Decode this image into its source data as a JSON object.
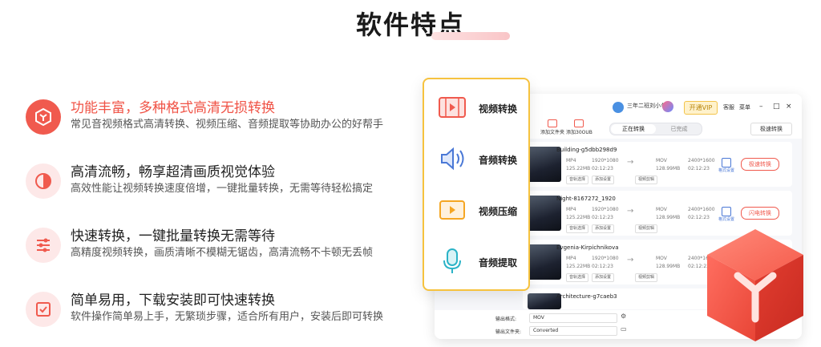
{
  "page_title": "软件特点",
  "features": [
    {
      "title": "功能丰富，多种格式高清无损转换",
      "desc": "常见音视频格式高清转换、视频压缩、音频提取等协助办公的好帮手",
      "icon": "cube-icon",
      "active": true
    },
    {
      "title": "高清流畅，畅享超清画质视觉体验",
      "desc": "高效性能让视频转换速度倍增，一键批量转换，无需等待轻松搞定",
      "icon": "contrast-icon",
      "active": false
    },
    {
      "title": "快速转换，一键批量转换无需等待",
      "desc": "高精度视频转换，画质清晰不模糊无锯齿，高清流畅不卡顿无丢帧",
      "icon": "sliders-icon",
      "active": false
    },
    {
      "title": "简单易用，下载安装即可快速转换",
      "desc": "软件操作简单易上手，无繁琐步骤，适合所有用户，安装后即可转换",
      "icon": "check-icon",
      "active": false
    }
  ],
  "card_items": [
    {
      "label": "视频转换",
      "icon": "video-film-icon"
    },
    {
      "label": "音频转换",
      "icon": "speaker-icon"
    },
    {
      "label": "视频压缩",
      "icon": "compress-icon"
    },
    {
      "label": "音频提取",
      "icon": "microphone-icon"
    }
  ],
  "app": {
    "user_name": "三年二班刘小冬",
    "vip_label": "开通VIP",
    "top_links": [
      "客服",
      "菜单"
    ],
    "toolbar": [
      "添加文件夹",
      "添加30OUB"
    ],
    "tabs": [
      "正在转换",
      "已完成"
    ],
    "speed_button": "极速转换",
    "rows": [
      {
        "name": "Building-g5dbb298d9",
        "src_format": "MP4",
        "src_res": "1920*1080",
        "src_size": "125.22MB",
        "src_time": "02:12:23",
        "dst_format": "MOV",
        "dst_res": "2400*1600",
        "dst_size": "128.99MB",
        "dst_time": "02:12:23",
        "btn_subtitle": "音轨选择",
        "btn_audio": "添加设置",
        "btn_edit": "视频剪辑",
        "fmt_label": "格式设置",
        "action": "极速转换"
      },
      {
        "name": "Night-8167272_1920",
        "src_format": "MP4",
        "src_res": "1920*1080",
        "src_size": "125.22MB",
        "src_time": "02:12:23",
        "dst_format": "MOV",
        "dst_res": "2400*1600",
        "dst_size": "128.99MB",
        "dst_time": "02:12:23",
        "btn_subtitle": "音轨选择",
        "btn_audio": "添加设置",
        "btn_edit": "视频剪辑",
        "fmt_label": "格式设置",
        "action": "闪电转换"
      },
      {
        "name": "Evgenia-Kirpichnikova",
        "src_format": "MP4",
        "src_res": "1920*1080",
        "src_size": "125.22MB",
        "src_time": "02:12:23",
        "dst_format": "MOV",
        "dst_res": "2400*1600",
        "dst_size": "128.99MB",
        "dst_time": "02:12:23",
        "btn_subtitle": "音轨选择",
        "btn_audio": "添加设置",
        "btn_edit": "视频剪辑",
        "fmt_label": "",
        "action": ""
      },
      {
        "name": "Architecture-g7caeb3",
        "src_format": "",
        "src_res": "",
        "src_size": "",
        "src_time": "",
        "dst_format": "",
        "dst_res": "",
        "dst_size": "",
        "dst_time": "",
        "btn_subtitle": "",
        "btn_audio": "",
        "btn_edit": "",
        "fmt_label": "",
        "action": ""
      }
    ],
    "output_format_label": "输出格式:",
    "output_format_value": "MOV",
    "output_folder_label": "输出文件夹:",
    "output_folder_value": "Converted"
  },
  "colors": {
    "accent": "#f05a4e",
    "card_border": "#f6c23e",
    "vip": "#f3c44a"
  }
}
